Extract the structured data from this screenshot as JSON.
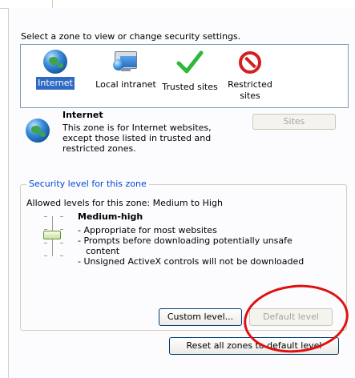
{
  "instruction": "Select a zone to view or change security settings.",
  "zones": [
    {
      "label_line1": "Internet",
      "label_line2": "",
      "icon": "globe-icon",
      "selected": true
    },
    {
      "label_line1": "Local intranet",
      "label_line2": "",
      "icon": "intranet-icon",
      "selected": false
    },
    {
      "label_line1": "Trusted sites",
      "label_line2": "",
      "icon": "checkmark-icon",
      "selected": false
    },
    {
      "label_line1": "Restricted",
      "label_line2": "sites",
      "icon": "no-entry-icon",
      "selected": false
    }
  ],
  "zone_description": {
    "title": "Internet",
    "line1": "This zone is for Internet websites,",
    "line2": "except those listed in trusted and",
    "line3": "restricted zones."
  },
  "sites_button": "Sites",
  "security_group": {
    "legend": "Security level for this zone",
    "allowed": "Allowed levels for this zone: Medium to High",
    "level_title": "Medium-high",
    "bullets": [
      "- Appropriate for most websites",
      "- Prompts before downloading potentially unsafe content",
      "- Unsigned ActiveX controls will not be downloaded"
    ]
  },
  "buttons": {
    "custom_level": "Custom level...",
    "default_level": "Default level",
    "reset_all": "Reset all zones to default level"
  },
  "colors": {
    "selection": "#316ac5",
    "legend_text": "#0046d5",
    "annotation": "#e01010",
    "check": "#2fb83a",
    "no_entry": "#d21f1f"
  }
}
